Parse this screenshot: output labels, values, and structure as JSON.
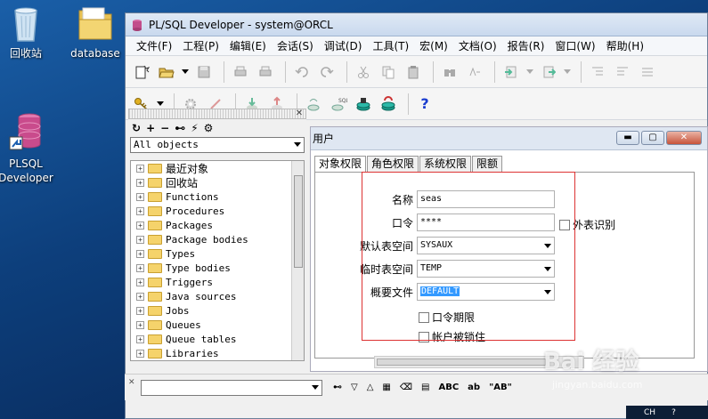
{
  "desktop": {
    "icons": [
      {
        "label": "回收站"
      },
      {
        "label": "database"
      },
      {
        "label": "PLSQL Developer"
      }
    ]
  },
  "window": {
    "title": "PL/SQL Developer - system@ORCL",
    "menu": [
      "文件(F)",
      "工程(P)",
      "编辑(E)",
      "会话(S)",
      "调试(D)",
      "工具(T)",
      "宏(M)",
      "文档(O)",
      "报告(R)",
      "窗口(W)",
      "帮助(H)"
    ]
  },
  "left_panel": {
    "filter_value": "All objects",
    "tree_items": [
      "最近对象",
      "回收站",
      "Functions",
      "Procedures",
      "Packages",
      "Package bodies",
      "Types",
      "Type bodies",
      "Triggers",
      "Java sources",
      "Jobs",
      "Queues",
      "Queue tables",
      "Libraries"
    ]
  },
  "user_dialog": {
    "title": "用户",
    "tabs": [
      "对象权限",
      "角色权限",
      "系统权限",
      "限额"
    ],
    "fields": {
      "name_label": "名称",
      "name_value": "seas",
      "password_label": "口令",
      "password_value": "****",
      "external_label": "外表识别",
      "default_ts_label": "默认表空间",
      "default_ts_value": "SYSAUX",
      "temp_ts_label": "临时表空间",
      "temp_ts_value": "TEMP",
      "profile_label": "概要文件",
      "profile_value": "DEFAULT",
      "expire_label": "口令期限",
      "locked_label": "帐户被锁住"
    }
  },
  "bottom_bar": {
    "abc_label": "ABC",
    "ab_label": "\"AB\""
  },
  "watermark": {
    "text": "Bai 经验",
    "sub": "jingyan.baidu.com"
  },
  "taskbar": {
    "lang": "CH"
  }
}
